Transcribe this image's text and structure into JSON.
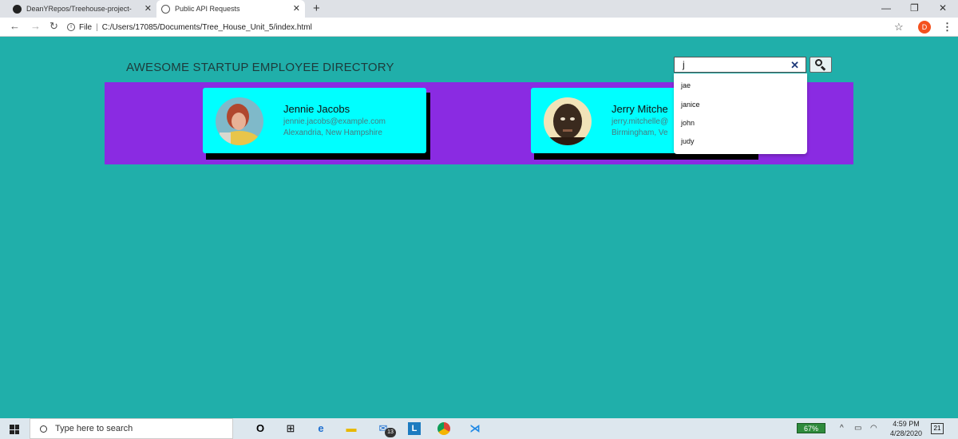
{
  "browser": {
    "tabs": [
      {
        "title": "DeanYRepos/Treehouse-project-",
        "icon": "github-icon"
      },
      {
        "title": "Public API Requests",
        "icon": "globe-icon"
      }
    ],
    "new_tab": "+",
    "close_glyph": "✕",
    "address": {
      "scheme_label": "File",
      "url": "C:/Users/17085/Documents/Tree_House_Unit_5/index.html"
    },
    "profile_initial": "D"
  },
  "page": {
    "title": "AWESOME STARTUP EMPLOYEE DIRECTORY",
    "search": {
      "value": "j",
      "clear_glyph": "✕"
    },
    "suggestions": [
      "jae",
      "janice",
      "john",
      "judy"
    ],
    "employees": [
      {
        "name": "Jennie Jacobs",
        "email": "jennie.jacobs@example.com",
        "location": "Alexandria, New Hampshire"
      },
      {
        "name": "Jerry Mitche",
        "email": "jerry.mitchelle@",
        "location": "Birmingham, Ve"
      }
    ],
    "colors": {
      "background": "#20AFAA",
      "gallery": "#8A2BE2",
      "card": "#00FFFF"
    }
  },
  "taskbar": {
    "search_placeholder": "Type here to search",
    "mail_badge": "13",
    "battery": "67%",
    "time": "4:59 PM",
    "date": "4/28/2020",
    "notifications": "21"
  }
}
